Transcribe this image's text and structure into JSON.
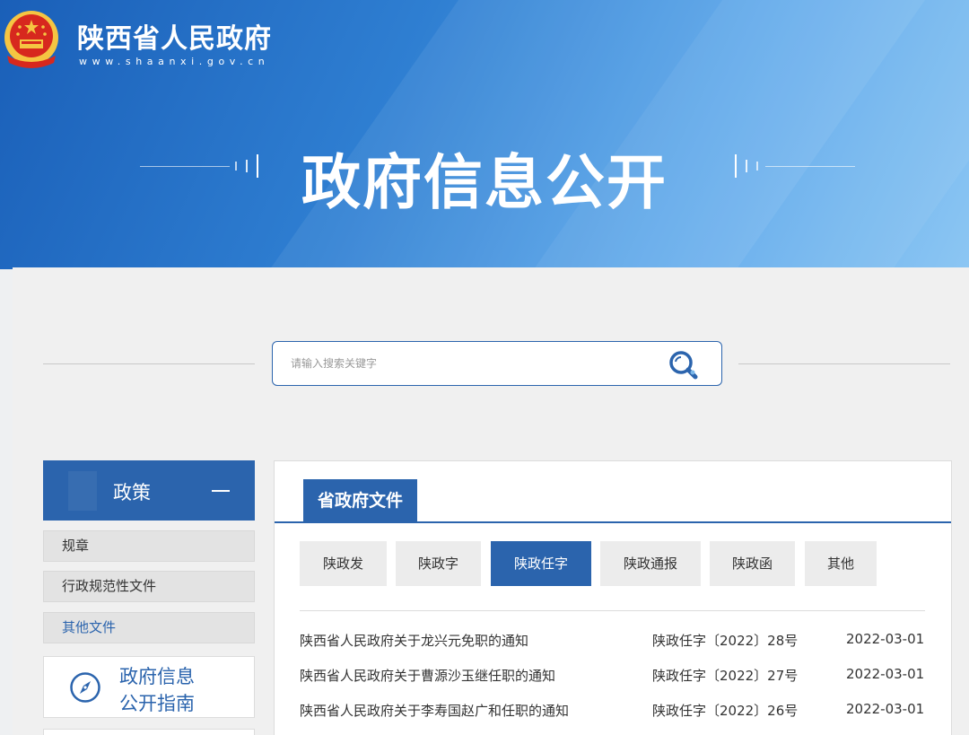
{
  "header": {
    "site_name": "陕西省人民政府",
    "site_url": "www.shaanxi.gov.cn",
    "banner_title": "政府信息公开"
  },
  "search": {
    "placeholder": "请输入搜索关键字"
  },
  "sidebar": {
    "header_title": "政策",
    "items": [
      {
        "label": "规章"
      },
      {
        "label": "行政规范性文件"
      },
      {
        "label": "其他文件"
      }
    ],
    "guide": {
      "line1": "政府信息",
      "line2": "公开指南"
    }
  },
  "content": {
    "tab": "省政府文件",
    "subtabs": [
      {
        "label": "陕政发"
      },
      {
        "label": "陕政字"
      },
      {
        "label": "陕政任字"
      },
      {
        "label": "陕政通报"
      },
      {
        "label": "陕政函"
      },
      {
        "label": "其他"
      }
    ],
    "active_subtab": "陕政任字",
    "rows": [
      {
        "title": "陕西省人民政府关于龙兴元免职的通知",
        "number": "陕政任字〔2022〕28号",
        "date": "2022-03-01"
      },
      {
        "title": "陕西省人民政府关于曹源沙玉继任职的通知",
        "number": "陕政任字〔2022〕27号",
        "date": "2022-03-01"
      },
      {
        "title": "陕西省人民政府关于李寿国赵广和任职的通知",
        "number": "陕政任字〔2022〕26号",
        "date": "2022-03-01"
      }
    ]
  },
  "colors": {
    "brand": "#2b64ad",
    "banner_start": "#1a5fb8",
    "emblem_red": "#d7281e",
    "emblem_gold": "#f5c542"
  }
}
